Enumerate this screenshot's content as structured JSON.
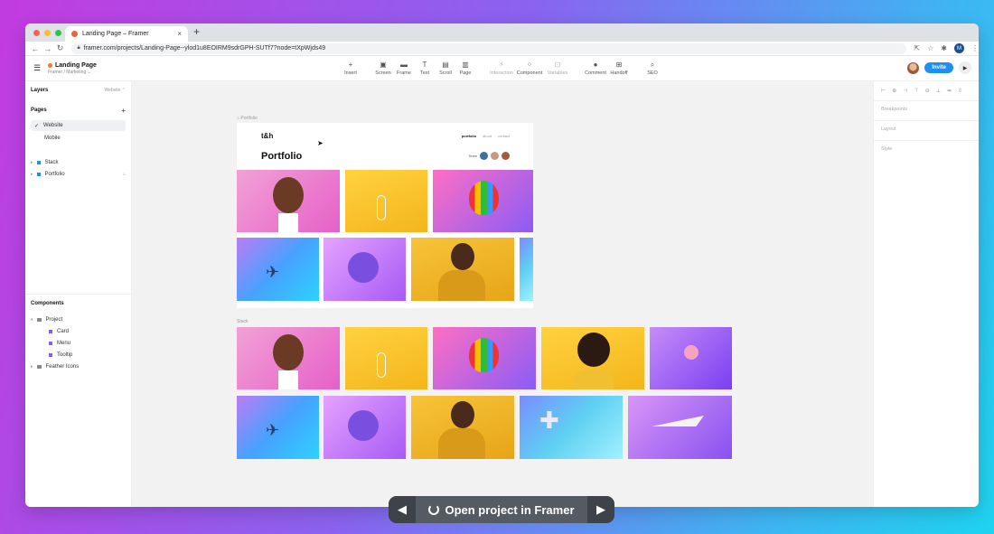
{
  "browser": {
    "tab_title": "Landing Page – Framer",
    "url": "framer.com/projects/Landing-Page--ylod1u8EOIRM9sdrGPH-SUTf7?node=tXpWjds49",
    "profile_initial": "M",
    "lights": [
      "#ff5f57",
      "#febc2e",
      "#28c840"
    ]
  },
  "toolbar": {
    "project_name": "Landing Page",
    "project_path": "Framer / Marketing ⌄",
    "tools": [
      {
        "label": "Insert",
        "icon": "plus-icon"
      },
      {
        "label": "Screen",
        "icon": "screen-icon"
      },
      {
        "label": "Frame",
        "icon": "frame-icon"
      },
      {
        "label": "Text",
        "icon": "text-icon"
      },
      {
        "label": "Scroll",
        "icon": "scroll-icon"
      },
      {
        "label": "Page",
        "icon": "page-icon"
      },
      {
        "label": "Interaction",
        "icon": "interaction-icon"
      },
      {
        "label": "Component",
        "icon": "component-icon"
      },
      {
        "label": "Variables",
        "icon": "variables-icon"
      },
      {
        "label": "Comment",
        "icon": "comment-icon"
      },
      {
        "label": "Handoff",
        "icon": "handoff-icon"
      },
      {
        "label": "SEO",
        "icon": "seo-icon"
      }
    ],
    "invite_label": "Invite"
  },
  "left": {
    "layers_label": "Layers",
    "layers_select": "Website ⌃",
    "pages_label": "Pages",
    "pages": [
      "Website",
      "Mobile"
    ],
    "layers": [
      "Stack",
      "Portfolio"
    ],
    "components_label": "Components",
    "components": [
      {
        "label": "Project",
        "level": 0
      },
      {
        "label": "Card",
        "level": 1
      },
      {
        "label": "Menu",
        "level": 1
      },
      {
        "label": "Tooltip",
        "level": 1
      },
      {
        "label": "Feather Icons",
        "level": 0
      }
    ]
  },
  "canvas": {
    "frame1_label": "Portfolio",
    "frame2_label": "Stack",
    "portfolio": {
      "logo": "t&h",
      "title": "Portfolio",
      "nav": [
        "portfolio",
        "about",
        "contact"
      ],
      "team_label": "Team"
    }
  },
  "right": {
    "sections": [
      "Breakpoints",
      "Layout",
      "Style"
    ]
  },
  "cta": {
    "label": "Open project in Framer",
    "prev": "◀",
    "next": "▶"
  },
  "colors": {
    "accent": "#1e8ff5",
    "background_left": "#c23be0",
    "background_right": "#1ed3f0"
  }
}
